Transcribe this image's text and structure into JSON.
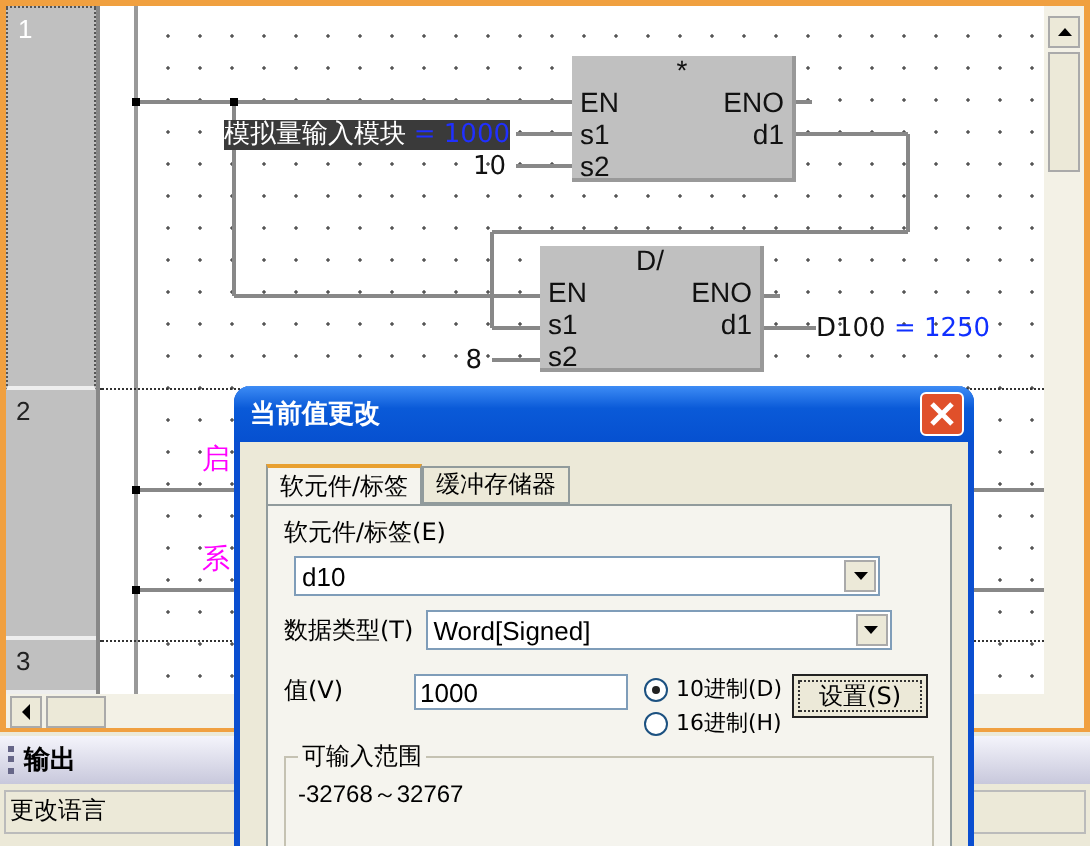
{
  "editor": {
    "rows": [
      {
        "number": "1",
        "selected": true
      },
      {
        "number": "2",
        "selected": false
      },
      {
        "number": "3",
        "selected": false
      }
    ],
    "blocks": [
      {
        "operator": "*",
        "pins_in": [
          "EN",
          "s1",
          "s2"
        ],
        "pins_out": [
          "ENO",
          "d1"
        ],
        "s1": {
          "name": "模拟量输入模块",
          "value": "= 1000",
          "highlighted": true
        },
        "s2": {
          "name": "10"
        }
      },
      {
        "operator": "D/",
        "pins_in": [
          "EN",
          "s1",
          "s2"
        ],
        "pins_out": [
          "ENO",
          "d1"
        ],
        "s2": {
          "name": "8"
        },
        "d1": {
          "name": "D100",
          "value": "= 1250"
        }
      }
    ],
    "comments": [
      "启",
      "系"
    ]
  },
  "output": {
    "title": "输出",
    "text": "更改语言"
  },
  "dialog": {
    "title": "当前值更改",
    "tabs": [
      {
        "label": "软元件/标签",
        "selected": true
      },
      {
        "label": "缓冲存储器",
        "selected": false
      }
    ],
    "device_label": "软元件/标签(E)",
    "device_value": "d10",
    "type_label": "数据类型(T)",
    "type_value": "Word[Signed]",
    "value_label": "值(V)",
    "value": "1000",
    "radios": [
      {
        "label": "10进制(D)",
        "selected": true
      },
      {
        "label": "16进制(H)",
        "selected": false
      }
    ],
    "set_button": "设置(S)",
    "range_title": "可输入范围",
    "range_value": "-32768～32767"
  }
}
